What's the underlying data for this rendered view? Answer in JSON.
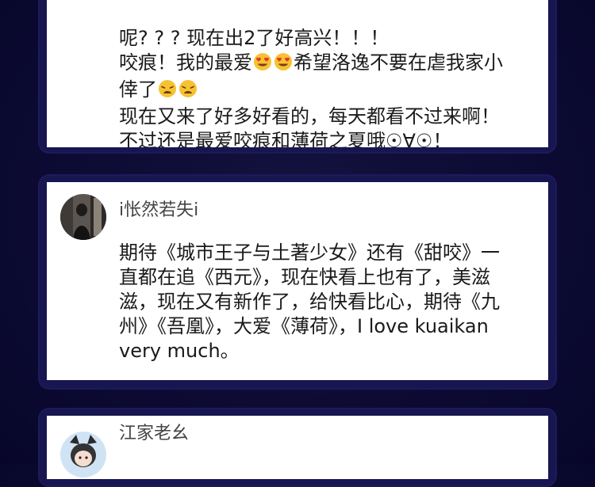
{
  "comments": [
    {
      "username": "",
      "lines": [
        "呢? ? ? 现在出2了好高兴！！！",
        "咬痕！我的最爱",
        "希望洛逸不要在虐我家小",
        "倖了",
        "现在又来了好多好看的，每天都看不过来啊！",
        "不过还是最爱咬痕和薄荷之夏哦☉∀☉！"
      ],
      "emojis": [
        "heart-eyes",
        "heart-eyes",
        "weary",
        "weary"
      ]
    },
    {
      "username": "i怅然若失i",
      "lines": [
        "期待《城市王子与土著少女》还有《甜咬》一",
        "直都在追《西元》，现在快看上也有了，美滋",
        "滋，现在又有新作了，给快看比心，期待《九",
        "州》《吾凰》，大爱《薄荷》，I love kuaikan",
        "very much。"
      ]
    },
    {
      "username": "江家老幺",
      "lines": []
    }
  ],
  "colors": {
    "page_background": "#0d0b33",
    "card_background": "#ffffff",
    "text": "#1a1a1a",
    "username": "#444444"
  }
}
